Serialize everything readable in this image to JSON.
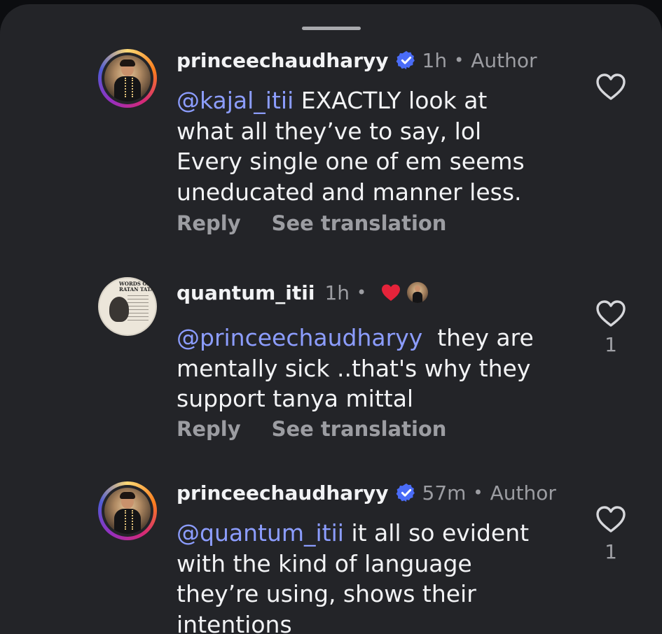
{
  "comments": [
    {
      "username": "princeechaudharyy",
      "time": "1h",
      "tag": "Author",
      "mention": "@kajal_itii",
      "text_lines": [
        " EXACTLY look at",
        "what all they’ve to say, lol",
        "Every single one of em seems",
        "uneducated and manner less."
      ],
      "reply_label": "Reply",
      "translate_label": "See translation",
      "likes": ""
    },
    {
      "username": "quantum_itii",
      "time": "1h",
      "avatar_text": "WORDS OF RATAN TATA",
      "mention": "@princeechaudharyy",
      "text_lines": [
        "  they are",
        "mentally sick ..that's why they",
        "support tanya mittal"
      ],
      "reply_label": "Reply",
      "translate_label": "See translation",
      "likes": "1"
    },
    {
      "username": "princeechaudharyy",
      "time": "57m",
      "tag": "Author",
      "mention": "@quantum_itii",
      "text_lines": [
        " it all so evident",
        "with the kind of language",
        "they’re using, shows their",
        "intentions"
      ],
      "likes": "1"
    }
  ],
  "separator": "•",
  "colors": {
    "background": "#232428",
    "mention": "#8c9dff",
    "verified": "#4a6cf7",
    "heart": "#e5233a"
  },
  "icons": {
    "verified": "verified-badge-icon",
    "like": "heart-outline-icon",
    "author_liked": "red-heart-icon"
  }
}
